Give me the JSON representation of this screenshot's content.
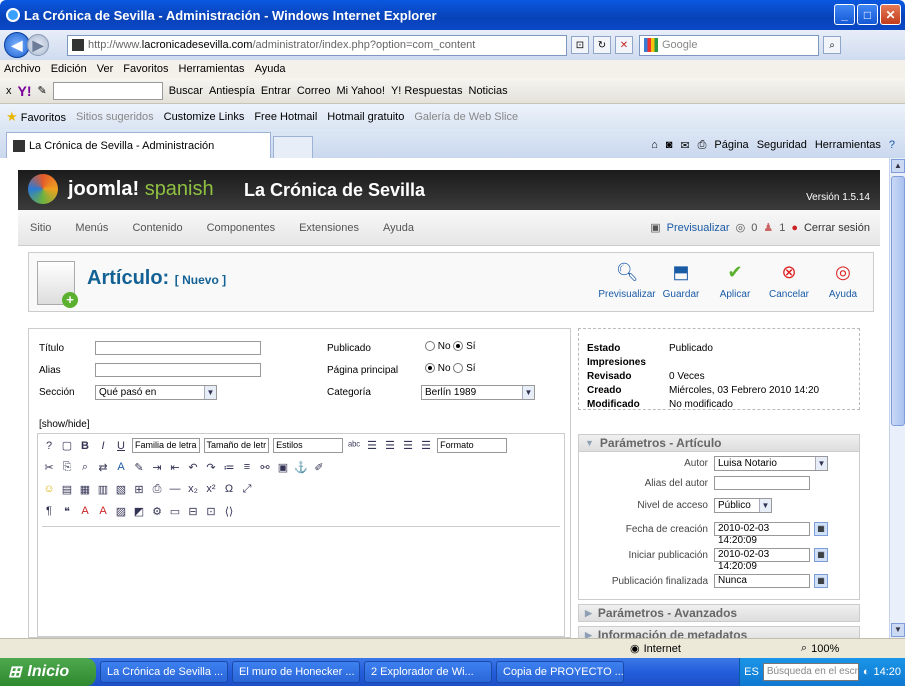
{
  "window": {
    "title": "La Crónica de Sevilla - Administración - Windows Internet Explorer"
  },
  "address": {
    "url_prefix": "http://www.",
    "url_domain": "lacronicadesevilla.com",
    "url_path": "/administrator/index.php?option=com_content",
    "search_placeholder": "Google"
  },
  "menubar": [
    "Archivo",
    "Edición",
    "Ver",
    "Favoritos",
    "Herramientas",
    "Ayuda"
  ],
  "yahoo_toolbar": {
    "buscar": "Buscar",
    "antiespia": "Antiespía",
    "entrar": "Entrar",
    "correo": "Correo",
    "mi_yahoo": "Mi Yahoo!",
    "respuestas": "Y! Respuestas",
    "noticias": "Noticias"
  },
  "favorites": {
    "label": "Favoritos",
    "items": [
      "Sitios sugeridos",
      "Customize Links",
      "Free Hotmail",
      "Hotmail gratuito",
      "Galería de Web Slice"
    ]
  },
  "tab": {
    "title": "La Crónica de Sevilla - Administración",
    "tools": [
      "Página",
      "Seguridad",
      "Herramientas"
    ]
  },
  "joomla": {
    "brand": "joomla!",
    "brand_suffix": "spanish",
    "site": "La Crónica de Sevilla",
    "version": "Versión 1.5.14",
    "menu": [
      "Sitio",
      "Menús",
      "Contenido",
      "Componentes",
      "Extensiones",
      "Ayuda"
    ],
    "preview_link": "Previsualizar",
    "count1": "0",
    "count2": "1",
    "logout": "Cerrar sesión"
  },
  "article": {
    "title": "Artículo:",
    "subtitle": "[ Nuevo ]",
    "tools": [
      "Previsualizar",
      "Guardar",
      "Aplicar",
      "Cancelar",
      "Ayuda"
    ]
  },
  "form": {
    "titulo_label": "Título",
    "alias_label": "Alias",
    "seccion_label": "Sección",
    "seccion_value": "Qué pasó en",
    "publicado_label": "Publicado",
    "pagina_label": "Página principal",
    "categoria_label": "Categoría",
    "categoria_value": "Berlín 1989",
    "no": "No",
    "si": "Sí",
    "showhide": "[show/hide]",
    "familia": "Familia de letra",
    "tamano": "Tamaño de letr",
    "estilos": "Estilos",
    "formato": "Formato"
  },
  "info": {
    "estado_k": "Estado",
    "estado_v": "Publicado",
    "impresiones_k": "Impresiones",
    "impresiones_v": "",
    "revisado_k": "Revisado",
    "revisado_v": "0 Veces",
    "creado_k": "Creado",
    "creado_v": "Miércoles, 03 Febrero 2010 14:20",
    "modificado_k": "Modificado",
    "modificado_v": "No modificado"
  },
  "params": {
    "title": "Parámetros - Artículo",
    "autor_label": "Autor",
    "autor_value": "Luisa Notario",
    "alias_autor_label": "Alias del autor",
    "nivel_label": "Nivel de acceso",
    "nivel_value": "Público",
    "fecha_label": "Fecha de creación",
    "fecha_value": "2010-02-03 14:20:09",
    "iniciar_label": "Iniciar publicación",
    "iniciar_value": "2010-02-03 14:20:09",
    "fin_label": "Publicación finalizada",
    "fin_value": "Nunca",
    "avanzados": "Parámetros - Avanzados",
    "metadatos": "Información de metadatos"
  },
  "status": {
    "zone": "Internet",
    "zoom": "100%"
  },
  "taskbar": {
    "start": "Inicio",
    "items": [
      "La Crónica de Sevilla ...",
      "El muro de Honecker ...",
      "2 Explorador de Wi...",
      "Copia de PROYECTO ..."
    ],
    "lang": "ES",
    "search_placeholder": "Búsqueda en el escrito",
    "clock": "14:20"
  }
}
